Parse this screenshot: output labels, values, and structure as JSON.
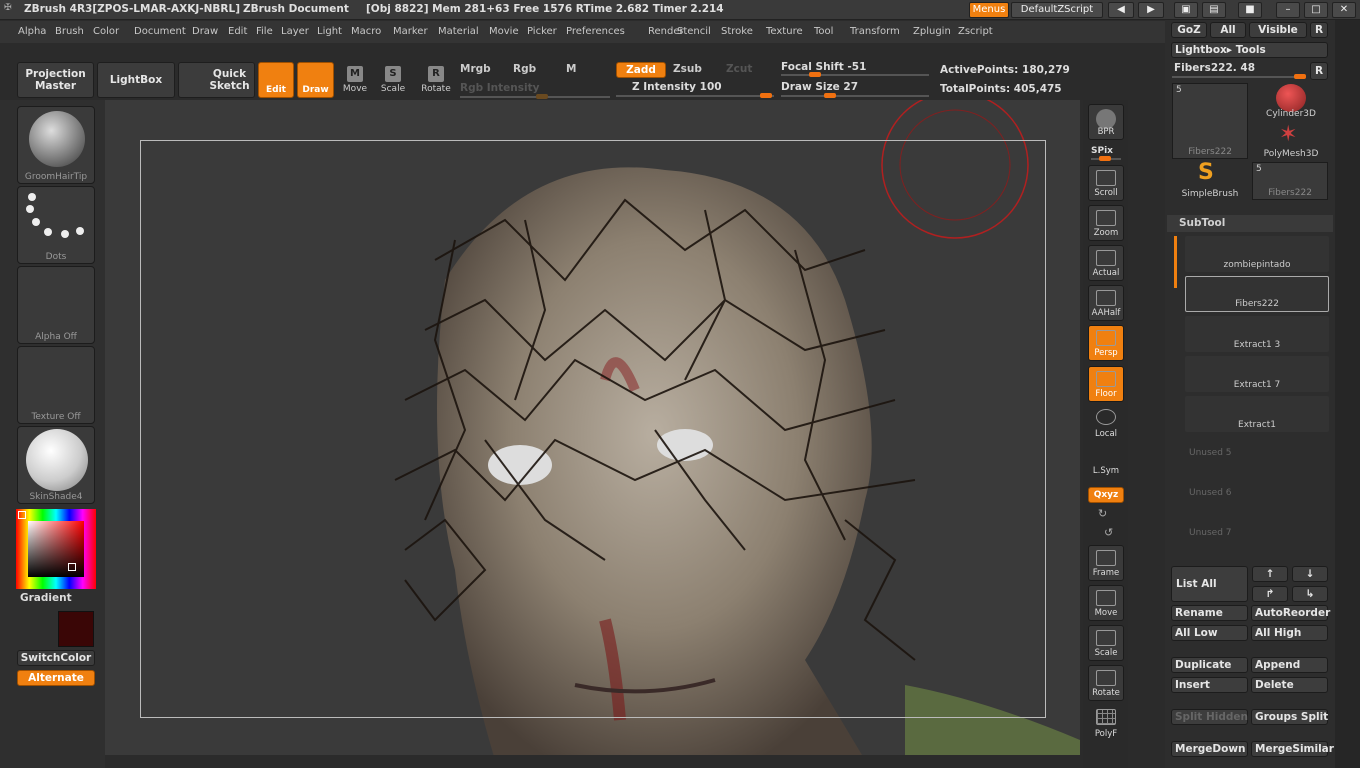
{
  "titlebar": {
    "app": "ZBrush 4R3[ZPOS-LMAR-AXKJ-NBRL]",
    "doc": "ZBrush Document",
    "stats": "[Obj 8822] Mem 281+63 Free 1576 RTime 2.682 Timer 2.214",
    "menus_btn": "Menus",
    "script_btn": "DefaultZScript"
  },
  "menu": [
    "Alpha",
    "Brush",
    "Color",
    "Document",
    "Draw",
    "Edit",
    "File",
    "Layer",
    "Light",
    "Macro",
    "Marker",
    "Material",
    "Movie",
    "Picker",
    "Preferences",
    "Render",
    "Stencil",
    "Stroke",
    "Texture",
    "Tool",
    "Transform",
    "Zplugin",
    "Zscript"
  ],
  "toolbar": {
    "projection_master": "Projection Master",
    "lightbox": "LightBox",
    "quick_sketch": "Quick Sketch",
    "edit": "Edit",
    "draw": "Draw",
    "move": "Move",
    "scale": "Scale",
    "rotate": "Rotate",
    "mrgb": "Mrgb",
    "rgb": "Rgb",
    "m": "M",
    "rgb_intensity": "Rgb Intensity",
    "zadd": "Zadd",
    "zsub": "Zsub",
    "zcut": "Zcut",
    "z_intensity": "Z Intensity 100",
    "focal_shift": "Focal Shift -51",
    "draw_size": "Draw Size 27",
    "active_points": "ActivePoints: 180,279",
    "total_points": "TotalPoints: 405,475"
  },
  "left": {
    "brush": "GroomHairTip",
    "stroke": "Dots",
    "alpha": "Alpha Off",
    "texture": "Texture Off",
    "material": "SkinShade4",
    "gradient": "Gradient",
    "switchcolor": "SwitchColor",
    "alternate": "Alternate"
  },
  "right_strip": {
    "bpr": "BPR",
    "spix": "SPix",
    "scroll": "Scroll",
    "zoom": "Zoom",
    "actual": "Actual",
    "aahalf": "AAHalf",
    "persp": "Persp",
    "floor": "Floor",
    "local": "Local",
    "lsym": "L.Sym",
    "xyz": "Qxyz",
    "frame": "Frame",
    "move": "Move",
    "scale": "Scale",
    "rotate": "Rotate",
    "polyf": "PolyF"
  },
  "tool": {
    "goz": "GoZ",
    "all": "All",
    "visible": "Visible",
    "r": "R",
    "lightbox_tools": "Lightbox▸ Tools",
    "current": "Fibers222. 48",
    "slot_count": "5",
    "slot_name": "Fibers222",
    "cylinder": "Cylinder3D",
    "polymesh": "PolyMesh3D",
    "simplebrush": "SimpleBrush",
    "slot2_count": "5",
    "slot2_name": "Fibers222"
  },
  "subtool": {
    "header": "SubTool",
    "items": [
      "zombiepintado",
      "Fibers222",
      "Extract1 3",
      "Extract1 7",
      "Extract1"
    ],
    "unused": [
      "Unused 5",
      "Unused 6",
      "Unused 7"
    ],
    "list_all": "List All",
    "rename": "Rename",
    "autoreorder": "AutoReorder",
    "all_low": "All Low",
    "all_high": "All High",
    "duplicate": "Duplicate",
    "append": "Append",
    "insert": "Insert",
    "delete": "Delete",
    "split_hidden": "Split Hidden",
    "groups_split": "Groups Split",
    "mergedown": "MergeDown",
    "mergesimilar": "MergeSimilar"
  },
  "colors": {
    "accent": "#f08010",
    "bg": "#2b2b2b",
    "secondary_color": "#3a0606"
  }
}
